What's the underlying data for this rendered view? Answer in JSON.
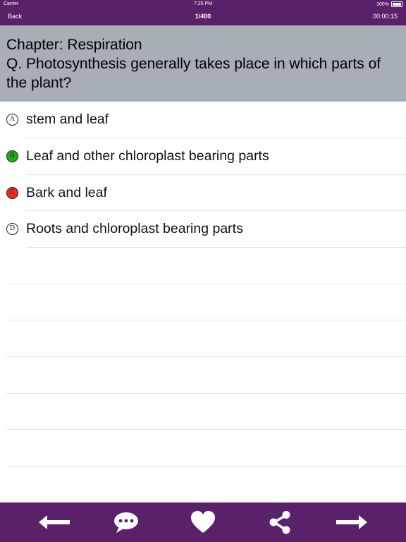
{
  "status_bar": {
    "carrier": "Carrier",
    "time": "7:25 PM",
    "battery": "100%"
  },
  "nav": {
    "back_label": "Back",
    "counter": "1/400",
    "timer": "00:00:15"
  },
  "question": {
    "chapter": "Chapter: Respiration",
    "text": "Q. Photosynthesis generally takes place in which parts of the plant?"
  },
  "options": [
    {
      "letter": "A",
      "text": "stem and leaf",
      "state": "neutral"
    },
    {
      "letter": "B",
      "text": "Leaf and other chloroplast bearing parts",
      "state": "correct"
    },
    {
      "letter": "C",
      "text": "Bark and leaf",
      "state": "wrong"
    },
    {
      "letter": "D",
      "text": "Roots and chloroplast bearing parts",
      "state": "neutral"
    }
  ],
  "toolbar": {
    "icons": [
      "arrow-left-icon",
      "comment-icon",
      "heart-icon",
      "share-icon",
      "arrow-right-icon"
    ]
  },
  "colors": {
    "bar": "#5a2069",
    "question_bg": "#a7aeb6",
    "correct": "#17b317",
    "wrong": "#ee2a1a"
  }
}
